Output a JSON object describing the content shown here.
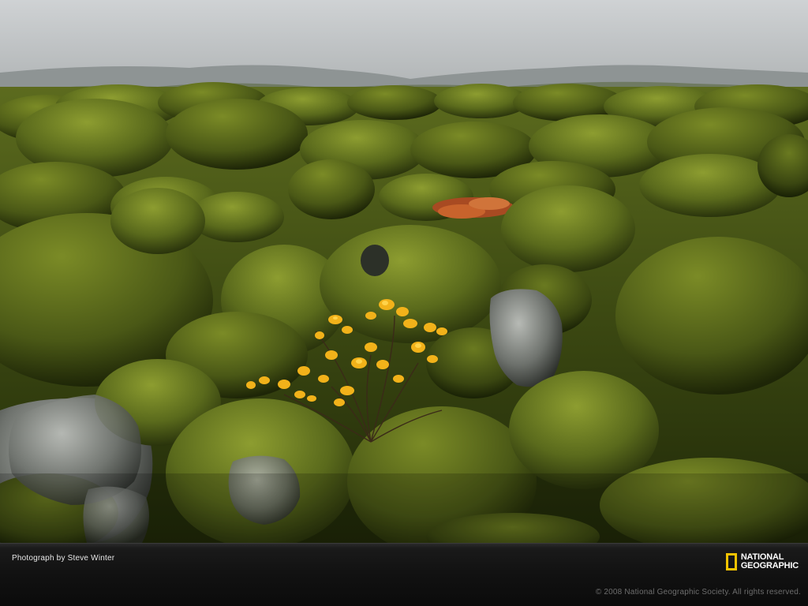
{
  "photo": {
    "subject": "moss-covered-lava-field",
    "colors": {
      "sky": "#bfc2c4",
      "moss_light": "#7a8a2a",
      "moss_mid": "#4f5d18",
      "moss_dark": "#26300b",
      "rock": "#8a8d8a",
      "leaves": "#f2b21a",
      "red_shrub": "#c0542a"
    }
  },
  "footer": {
    "credit": "Photograph by Steve Winter",
    "copyright": "© 2008 National Geographic Society. All rights reserved.",
    "brand_line1": "NATIONAL",
    "brand_line2": "GEOGRAPHIC",
    "brand_color": "#f3c300",
    "icon": "yellow-border-icon"
  }
}
